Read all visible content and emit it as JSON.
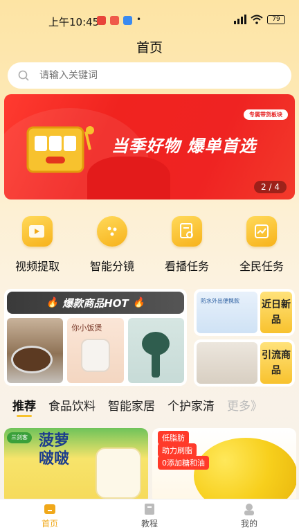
{
  "status_bar": {
    "time": "上午10:45",
    "battery": "79"
  },
  "header": {
    "title": "首页"
  },
  "search": {
    "placeholder": "请输入关键词"
  },
  "banner": {
    "tag": "专属带货板块",
    "headline": "当季好物 爆单首选",
    "page": "2 / 4"
  },
  "quick_menu": [
    {
      "label": "视频提取",
      "icon": "video-icon"
    },
    {
      "label": "智能分镜",
      "icon": "dice-icon"
    },
    {
      "label": "看播任务",
      "icon": "task-search-icon"
    },
    {
      "label": "全民任务",
      "icon": "chart-task-icon"
    }
  ],
  "hot_panel": {
    "title": "爆款商品HOT",
    "img2_text": "你小饭煲"
  },
  "side_cards": [
    {
      "label": "近日新品",
      "img_text": "防水外出便携款"
    },
    {
      "label": "引流商品"
    }
  ],
  "categories": [
    {
      "label": "推荐",
      "active": true
    },
    {
      "label": "食品饮料"
    },
    {
      "label": "智能家居"
    },
    {
      "label": "个护家清"
    },
    {
      "label": "更多》"
    }
  ],
  "products": {
    "left": {
      "brand": "三剑客",
      "title": "菠萝\n啵啵"
    },
    "right": {
      "badges": [
        "低脂肪",
        "助力刷脂",
        "0添加糖和油"
      ]
    }
  },
  "bottom_nav": [
    {
      "label": "首页",
      "active": true,
      "icon": "home-icon"
    },
    {
      "label": "教程",
      "icon": "book-icon"
    },
    {
      "label": "我的",
      "icon": "user-icon"
    }
  ],
  "colors": {
    "accent": "#f7c22e",
    "banner_red": "#ef2322",
    "nav_active": "#f0a81a"
  }
}
